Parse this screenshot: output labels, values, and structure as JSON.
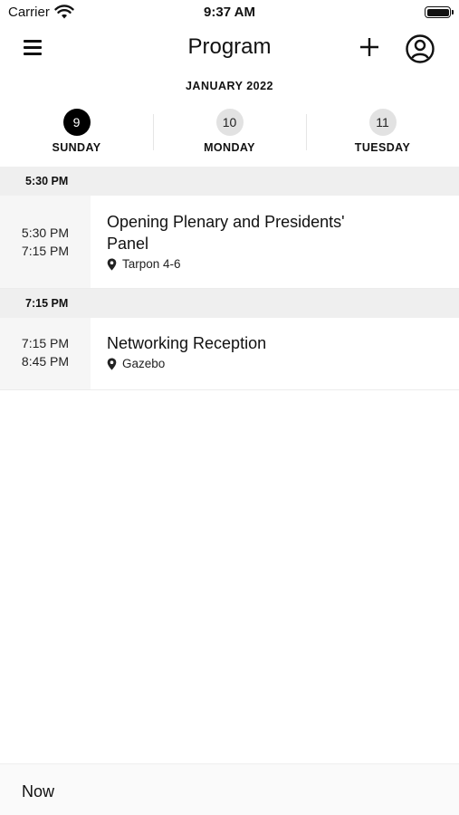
{
  "status_bar": {
    "carrier": "Carrier",
    "time": "9:37 AM",
    "wifi_icon": "wifi-icon",
    "battery_icon": "battery-icon"
  },
  "nav": {
    "title": "Program",
    "menu_icon": "hamburger-menu-icon",
    "add_icon": "plus-icon",
    "profile_icon": "user-circle-icon"
  },
  "calendar": {
    "month": "JANUARY 2022",
    "days": [
      {
        "num": "9",
        "name": "SUNDAY",
        "active": true
      },
      {
        "num": "10",
        "name": "MONDAY",
        "active": false
      },
      {
        "num": "11",
        "name": "TUESDAY",
        "active": false
      }
    ]
  },
  "schedule": {
    "groups": [
      {
        "header": "5:30 PM",
        "sessions": [
          {
            "start": "5:30 PM",
            "end": "7:15 PM",
            "title": "Opening Plenary and Presidents' Panel",
            "location": "Tarpon 4-6"
          }
        ]
      },
      {
        "header": "7:15 PM",
        "sessions": [
          {
            "start": "7:15 PM",
            "end": "8:45 PM",
            "title": "Networking Reception",
            "location": "Gazebo"
          }
        ]
      }
    ]
  },
  "bottom_bar": {
    "now_label": "Now"
  },
  "colors": {
    "accent": "#000000",
    "header_bg": "#efefef",
    "time_column_bg": "#f6f6f6",
    "inactive_day_bg": "#e2e2e2"
  }
}
